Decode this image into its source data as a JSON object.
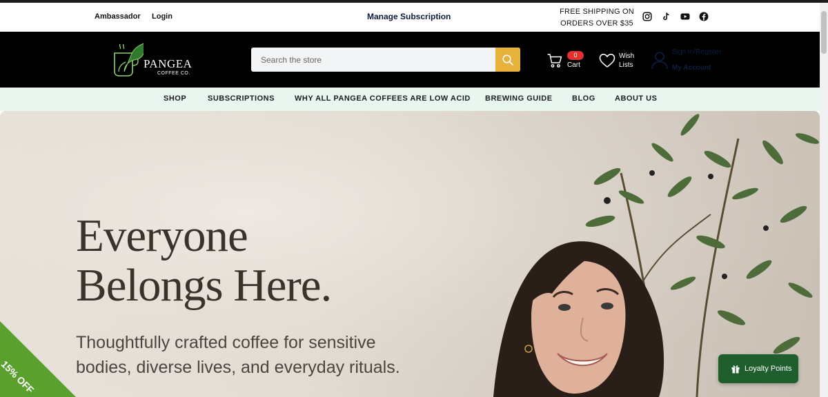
{
  "utility_bar": {
    "ambassador_label": "Ambassador",
    "login_label": "Login",
    "manage_subscription_label": "Manage Subscription",
    "shipping_line1": "FREE SHIPPING ON",
    "shipping_line2": "ORDERS OVER $35",
    "social_icons": [
      "instagram-icon",
      "tiktok-icon",
      "youtube-icon",
      "facebook-icon"
    ]
  },
  "header": {
    "logo": {
      "name": "PANGEA",
      "subtitle": "COFFEE CO."
    },
    "search": {
      "placeholder": "Search the store"
    },
    "cart": {
      "label": "Cart",
      "count": "0"
    },
    "wishlist": {
      "line1": "Wish",
      "line2": "Lists"
    },
    "account": {
      "line1": "Sign In/Register",
      "line2": "My Account"
    }
  },
  "nav": {
    "items": [
      {
        "label": "SHOP"
      },
      {
        "label": "SUBSCRIPTIONS"
      },
      {
        "label": "WHY ALL PANGEA COFFEES ARE LOW ACID"
      },
      {
        "label": "BREWING GUIDE"
      },
      {
        "label": "BLOG"
      },
      {
        "label": "ABOUT US"
      }
    ]
  },
  "hero": {
    "title_line1": "Everyone",
    "title_line2": "Belongs Here.",
    "subtitle_line1": "Thoughtfully crafted coffee for sensitive",
    "subtitle_line2": "bodies, diverse lives, and everyday rituals."
  },
  "promo": {
    "label": "15% OFF"
  },
  "loyalty": {
    "label": "Loyalty Points"
  },
  "colors": {
    "header_bg": "#000000",
    "search_button": "#e8b13a",
    "cart_badge": "#e53030",
    "nav_bg": "#e9f6ef",
    "promo_green": "#5aa02c",
    "loyalty_green": "#1f5f2e",
    "hero_text": "#3b322c"
  }
}
